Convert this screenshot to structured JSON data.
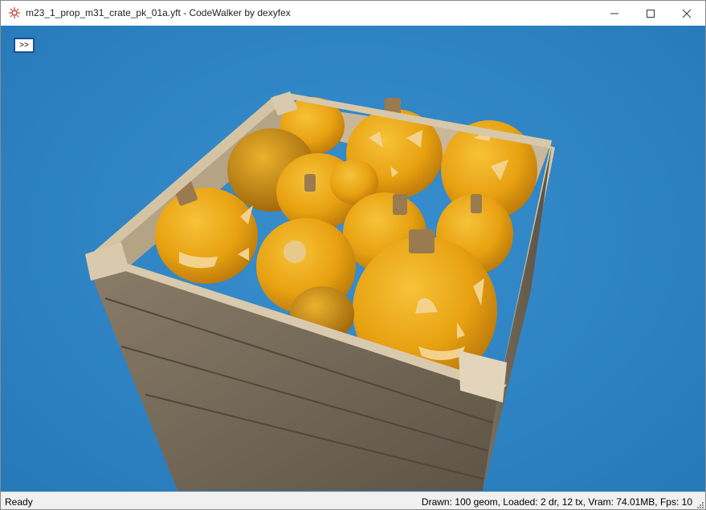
{
  "window": {
    "title": "m23_1_prop_m31_crate_pk_01a.yft - CodeWalker by dexyfex",
    "icon": "codewalker-icon",
    "controls": [
      "minimize-icon",
      "maximize-icon",
      "close-icon"
    ]
  },
  "viewport": {
    "toggle_label": ">>",
    "background_color": "#2f84c4"
  },
  "status": {
    "left": "Ready",
    "right": "Drawn: 100 geom, Loaded: 2 dr, 12 tx, Vram: 74.01MB, Fps: 10"
  }
}
